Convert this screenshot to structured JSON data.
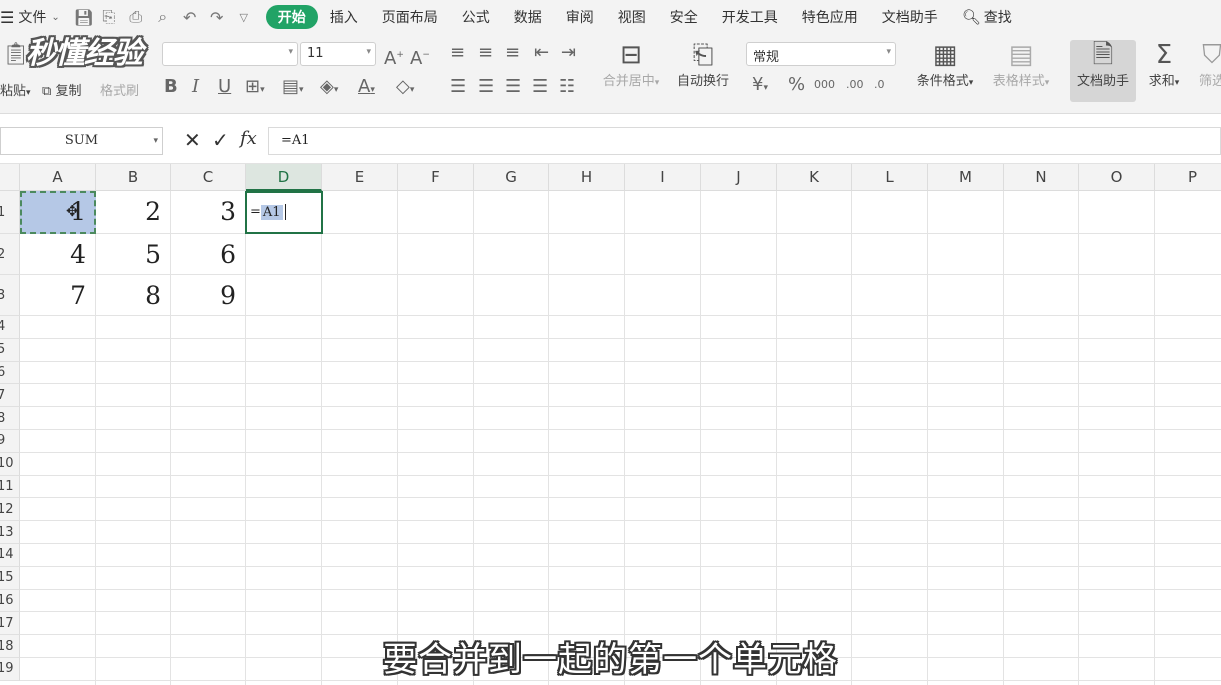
{
  "menubar": {
    "file": "文件",
    "tabs": [
      "开始",
      "插入",
      "页面布局",
      "公式",
      "数据",
      "审阅",
      "视图",
      "安全",
      "开发工具",
      "特色应用",
      "文档助手"
    ],
    "active_tab": "开始",
    "search": "查找"
  },
  "watermark": "秒懂经验",
  "ribbon": {
    "paste": "粘贴",
    "copy": "复制",
    "format_painter": "格式刷",
    "font_size": "11",
    "merge_center": "合并居中",
    "wrap_text": "自动换行",
    "number_format": "常规",
    "conditional_format": "条件格式",
    "table_style": "表格样式",
    "doc_assistant": "文档助手",
    "sum": "求和",
    "filter": "筛选"
  },
  "formula_bar": {
    "name_box": "SUM",
    "formula": "=A1"
  },
  "columns": [
    "A",
    "B",
    "C",
    "D",
    "E",
    "F",
    "G",
    "H",
    "I",
    "J",
    "K",
    "L",
    "M",
    "N",
    "O",
    "P"
  ],
  "active_column": "D",
  "rows": [
    "1",
    "2",
    "3",
    "4",
    "5",
    "6",
    "7",
    "8",
    "9",
    "10",
    "11",
    "12",
    "13",
    "14",
    "15",
    "16",
    "17",
    "18",
    "19"
  ],
  "cells": [
    [
      "1",
      "2",
      "3"
    ],
    [
      "4",
      "5",
      "6"
    ],
    [
      "7",
      "8",
      "9"
    ]
  ],
  "editing_cell": {
    "prefix": "=",
    "ref": "A1"
  },
  "subtitle": "要合并到一起的第一个单元格"
}
